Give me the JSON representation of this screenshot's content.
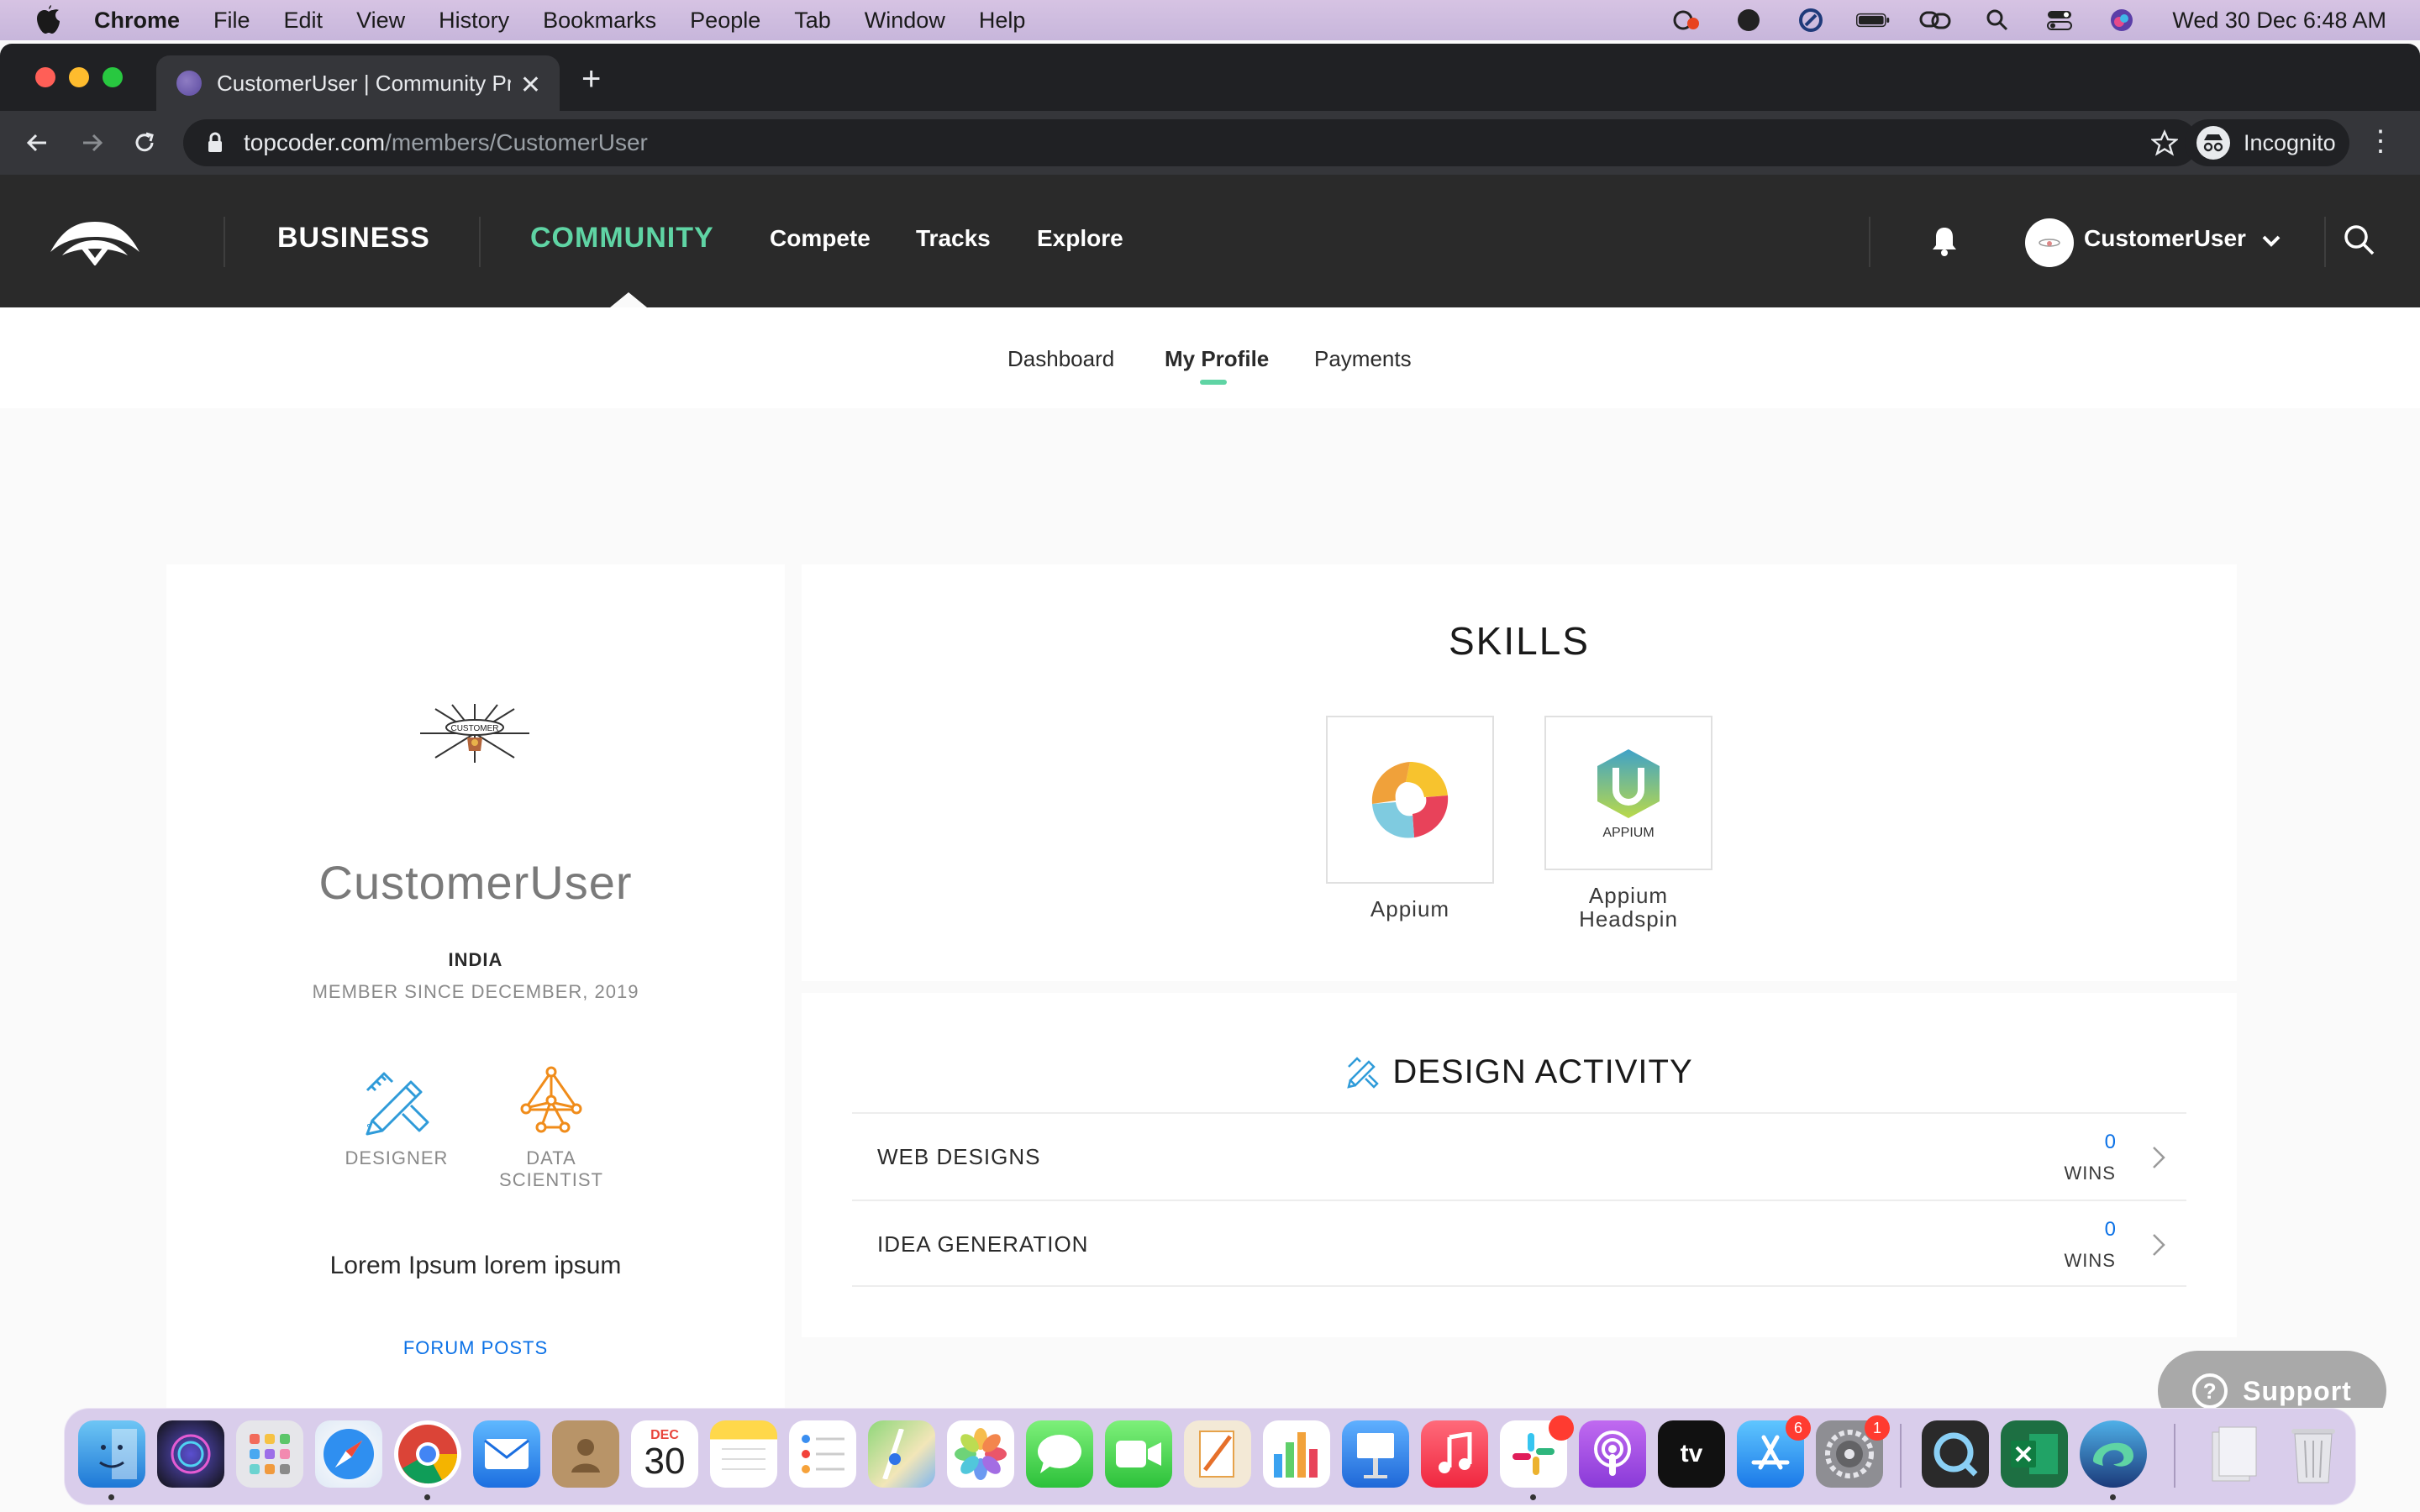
{
  "menubar": {
    "app_name": "Chrome",
    "menus": [
      "File",
      "Edit",
      "View",
      "History",
      "Bookmarks",
      "People",
      "Tab",
      "Window",
      "Help"
    ],
    "clock": "Wed 30 Dec  6:48 AM"
  },
  "browser": {
    "tab_title": "CustomerUser | Community Pro",
    "url_host": "topcoder.com",
    "url_path": "/members/CustomerUser",
    "incognito_label": "Incognito"
  },
  "site_nav": {
    "business": "BUSINESS",
    "community": "COMMUNITY",
    "links": [
      "Compete",
      "Tracks",
      "Explore"
    ],
    "username": "CustomerUser",
    "accent_color": "#5fd4a4"
  },
  "subnav": {
    "items": [
      "Dashboard",
      "My Profile",
      "Payments"
    ],
    "active": "My Profile"
  },
  "profile": {
    "photo_text": "CUSTOMER",
    "handle": "CustomerUser",
    "country": "INDIA",
    "member_since": "MEMBER SINCE DECEMBER, 2019",
    "tracks": [
      {
        "label": "DESIGNER",
        "icon": "designer-icon",
        "color": "#2f9bd9"
      },
      {
        "label_line1": "DATA",
        "label_line2": "SCIENTIST",
        "icon": "data-scientist-icon",
        "color": "#f08c1a"
      }
    ],
    "description": "Lorem Ipsum lorem ipsum",
    "forum_link": "FORUM POSTS"
  },
  "skills": {
    "title": "SKILLS",
    "items": [
      {
        "name": "Appium",
        "icon": "appium-icon"
      },
      {
        "name_line1": "Appium",
        "name_line2": "Headspin",
        "icon": "appium-headspin-icon",
        "icon_text": "APPIUM"
      }
    ]
  },
  "design_activity": {
    "title": "DESIGN ACTIVITY",
    "rows": [
      {
        "name": "WEB DESIGNS",
        "count": "0",
        "unit": "WINS"
      },
      {
        "name": "IDEA GENERATION",
        "count": "0",
        "unit": "WINS"
      }
    ]
  },
  "support": {
    "label": "Support",
    "icon": "?"
  },
  "dock": {
    "calendar_month": "DEC",
    "calendar_day": "30",
    "appletv_label": "tv",
    "badges": {
      "slack": "",
      "appstore": "6",
      "settings": "1"
    }
  }
}
